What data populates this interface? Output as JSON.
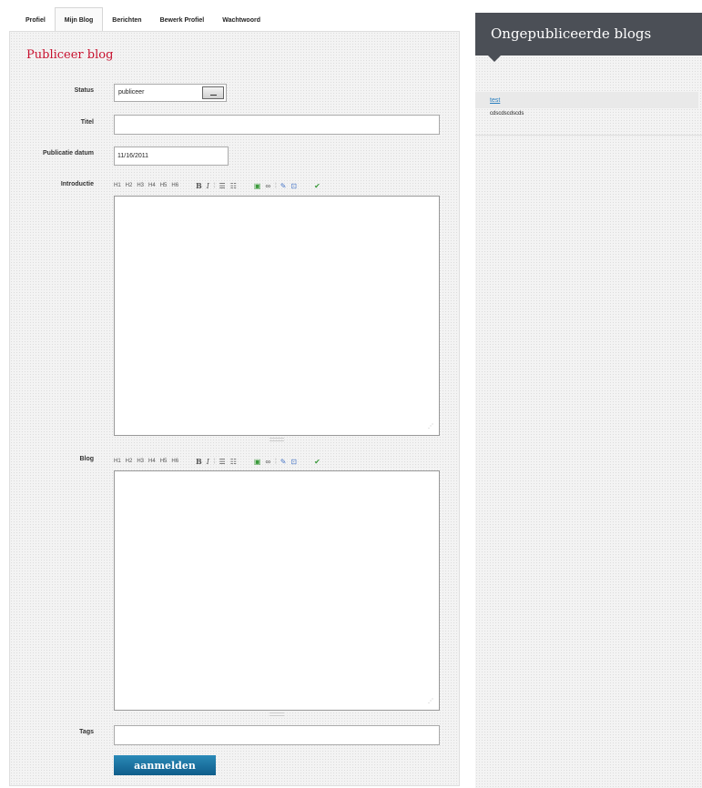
{
  "tabs": [
    {
      "label": "Profiel"
    },
    {
      "label": "Mijn Blog"
    },
    {
      "label": "Berichten"
    },
    {
      "label": "Bewerk Profiel"
    },
    {
      "label": "Wachtwoord"
    }
  ],
  "form": {
    "title": "Publiceer blog",
    "status_label": "Status",
    "status_value": "publiceer",
    "titel_label": "Titel",
    "titel_value": "",
    "datum_label": "Publicatie datum",
    "datum_value": "11/16/2011",
    "intro_label": "Introductie",
    "blog_label": "Blog",
    "tags_label": "Tags",
    "tags_value": "",
    "submit_label": "aanmelden"
  },
  "toolbar": {
    "h1": "H1",
    "h2": "H2",
    "h3": "H3",
    "h4": "H4",
    "h5": "H5",
    "h6": "H6",
    "bold": "B",
    "italic": "I",
    "ul": "☰",
    "ol": "☷",
    "image": "▣",
    "link": "∞",
    "paste": "✎",
    "html": "⊡",
    "check": "✔",
    "sep": "¦"
  },
  "sidebar": {
    "title": "Ongepubliceerde blogs",
    "items": [
      {
        "title": "test",
        "description": "cdscdscdscds"
      }
    ]
  }
}
